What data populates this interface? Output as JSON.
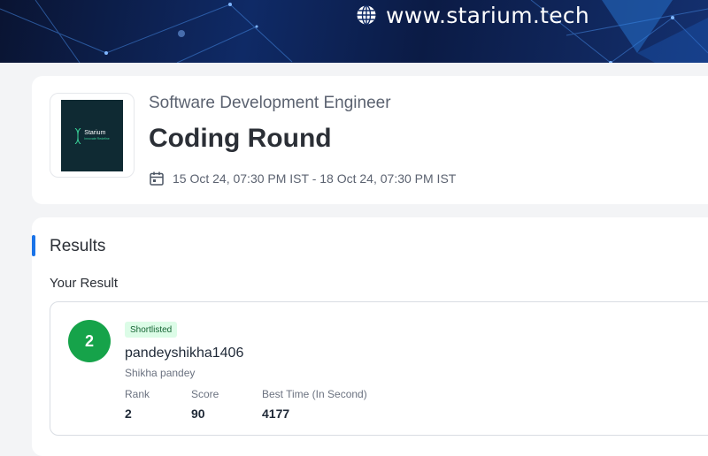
{
  "banner": {
    "site_url": "www.starium.tech",
    "globe_icon": "globe-icon"
  },
  "header": {
    "logo_name": "Starium",
    "logo_tagline": "Innovate Redefine",
    "subtitle": "Software Development Engineer",
    "title": "Coding Round",
    "date_range": "15 Oct 24, 07:30 PM IST - 18 Oct 24, 07:30 PM IST",
    "calendar_icon": "calendar-icon"
  },
  "results": {
    "section_title": "Results",
    "your_result_label": "Your Result",
    "entry": {
      "rank_badge": "2",
      "status": "Shortlisted",
      "username": "pandeyshikha1406",
      "full_name": "Shikha pandey",
      "stats": [
        {
          "label": "Rank",
          "value": "2"
        },
        {
          "label": "Score",
          "value": "90"
        },
        {
          "label": "Best Time (In Second)",
          "value": "4177"
        }
      ]
    }
  },
  "colors": {
    "accent": "#1a73e8",
    "rank_circle": "#16a34a",
    "badge_bg": "#dcfce7",
    "badge_text": "#166534"
  }
}
